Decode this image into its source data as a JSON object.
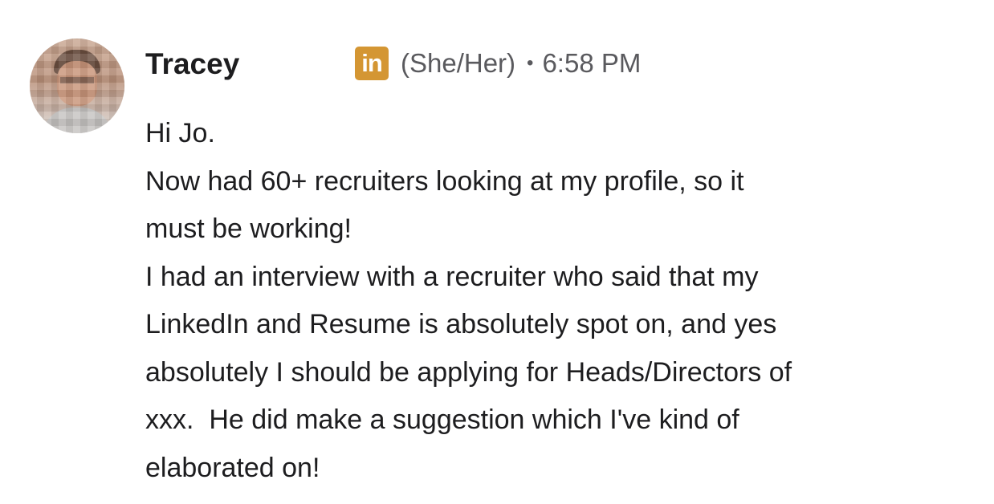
{
  "message": {
    "sender_name": "Tracey",
    "badge_icon": "linkedin-icon",
    "badge_text": "in",
    "badge_color": "#D49633",
    "pronouns": "(She/Her)",
    "separator": "•",
    "timestamp": "6:58 PM",
    "lines": [
      "Hi Jo.",
      "Now had 60+ recruiters looking at my profile, so it",
      "must be working!",
      "I had an interview with a recruiter who said that my",
      "LinkedIn and Resume is absolutely spot on, and yes",
      "absolutely I should be applying for Heads/Directors of",
      "xxx.  He did make a suggestion which I've kind of",
      "elaborated on!"
    ]
  }
}
